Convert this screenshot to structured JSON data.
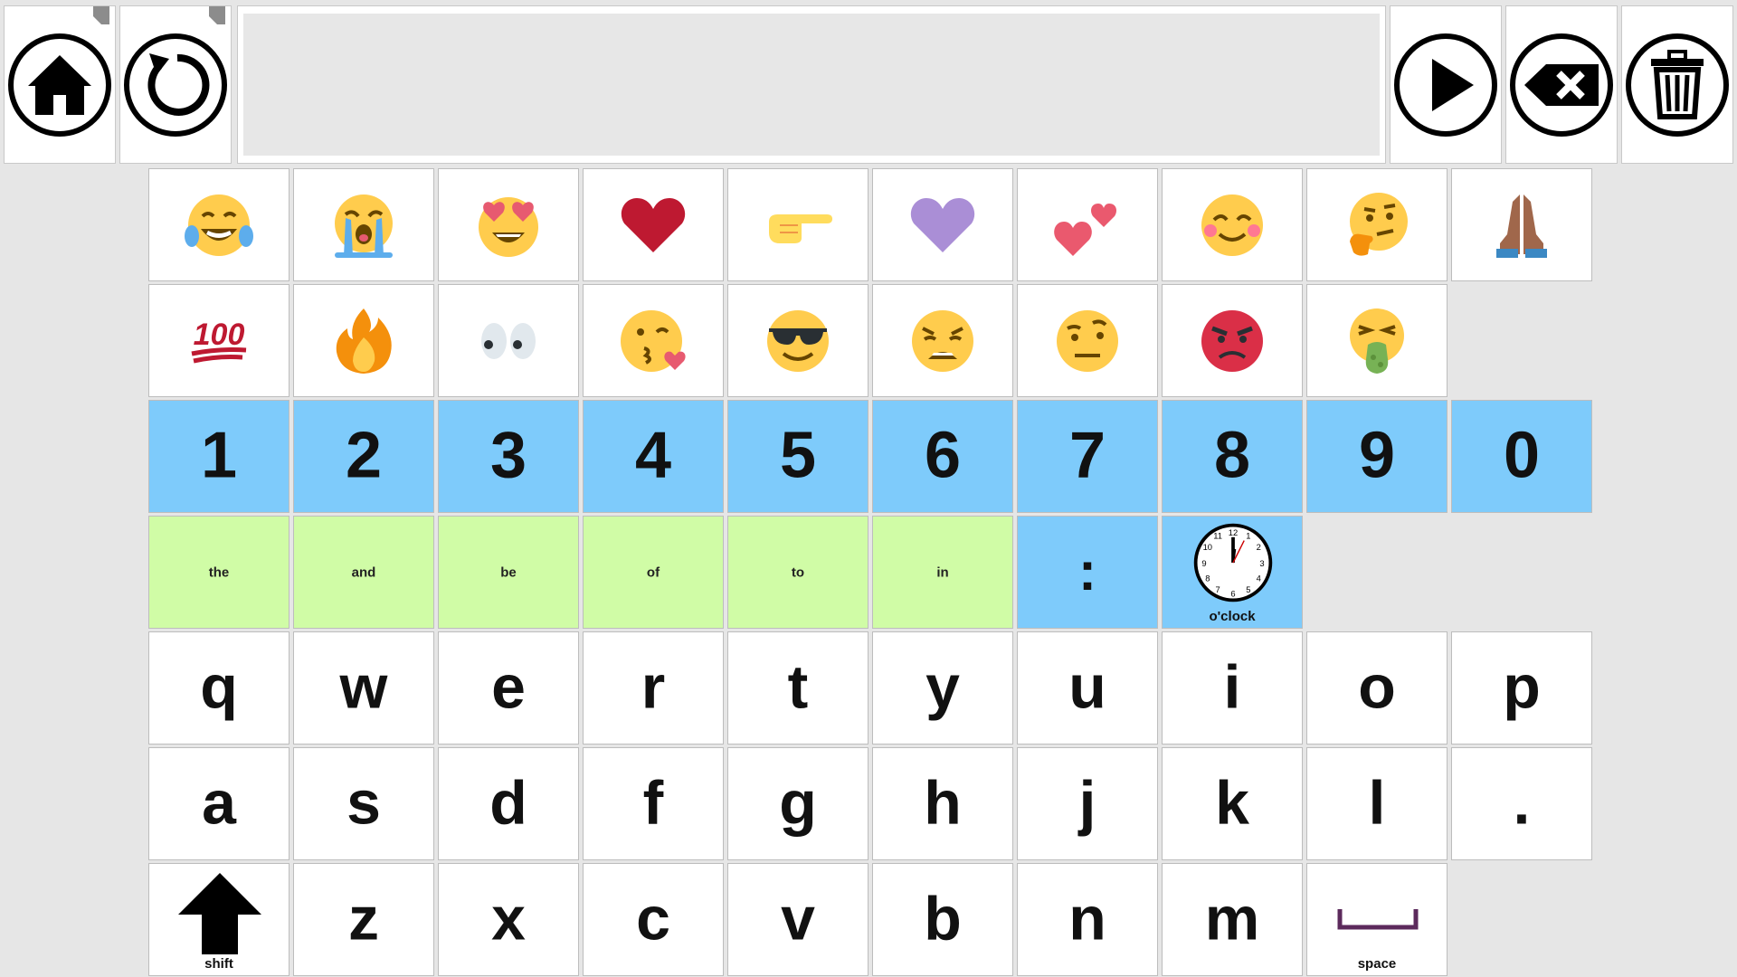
{
  "toolbar": {
    "home_icon": "home-icon",
    "undo_icon": "undo-icon",
    "speak_icon": "play-icon",
    "backspace_icon": "backspace-icon",
    "clear_icon": "trash-icon",
    "message": ""
  },
  "emoji_row_1": [
    "face-with-tears-of-joy",
    "loudly-crying-face",
    "heart-eyes",
    "red-heart",
    "backhand-index-pointing-right",
    "purple-heart",
    "two-hearts",
    "smiling-face-with-smiling-eyes",
    "thinking-face",
    "folded-hands"
  ],
  "emoji_row_2": [
    "hundred-points",
    "fire",
    "eyes",
    "face-blowing-a-kiss",
    "smiling-face-with-sunglasses",
    "weary-face",
    "face-with-raised-eyebrow",
    "pouting-face",
    "face-vomiting"
  ],
  "numbers": [
    "1",
    "2",
    "3",
    "4",
    "5",
    "6",
    "7",
    "8",
    "9",
    "0"
  ],
  "words": [
    "the",
    "and",
    "be",
    "of",
    "to",
    "in"
  ],
  "punct": {
    "colon": ":",
    "oclock_label": "o'clock",
    "oclock_icon": "clock-icon"
  },
  "letters_row_1": [
    "q",
    "w",
    "e",
    "r",
    "t",
    "y",
    "u",
    "i",
    "o",
    "p"
  ],
  "letters_row_2": [
    "a",
    "s",
    "d",
    "f",
    "g",
    "h",
    "j",
    "k",
    "l",
    "."
  ],
  "letters_row_3": [
    "z",
    "x",
    "c",
    "v",
    "b",
    "n",
    "m"
  ],
  "shift": {
    "label": "shift",
    "icon": "arrow-up-icon"
  },
  "space": {
    "label": "space",
    "icon": "space-icon"
  },
  "colors": {
    "number_key": "#7ecbfb",
    "word_key": "#d0fca6",
    "background": "#e6e6e6",
    "space_icon": "#5c2a5c"
  }
}
